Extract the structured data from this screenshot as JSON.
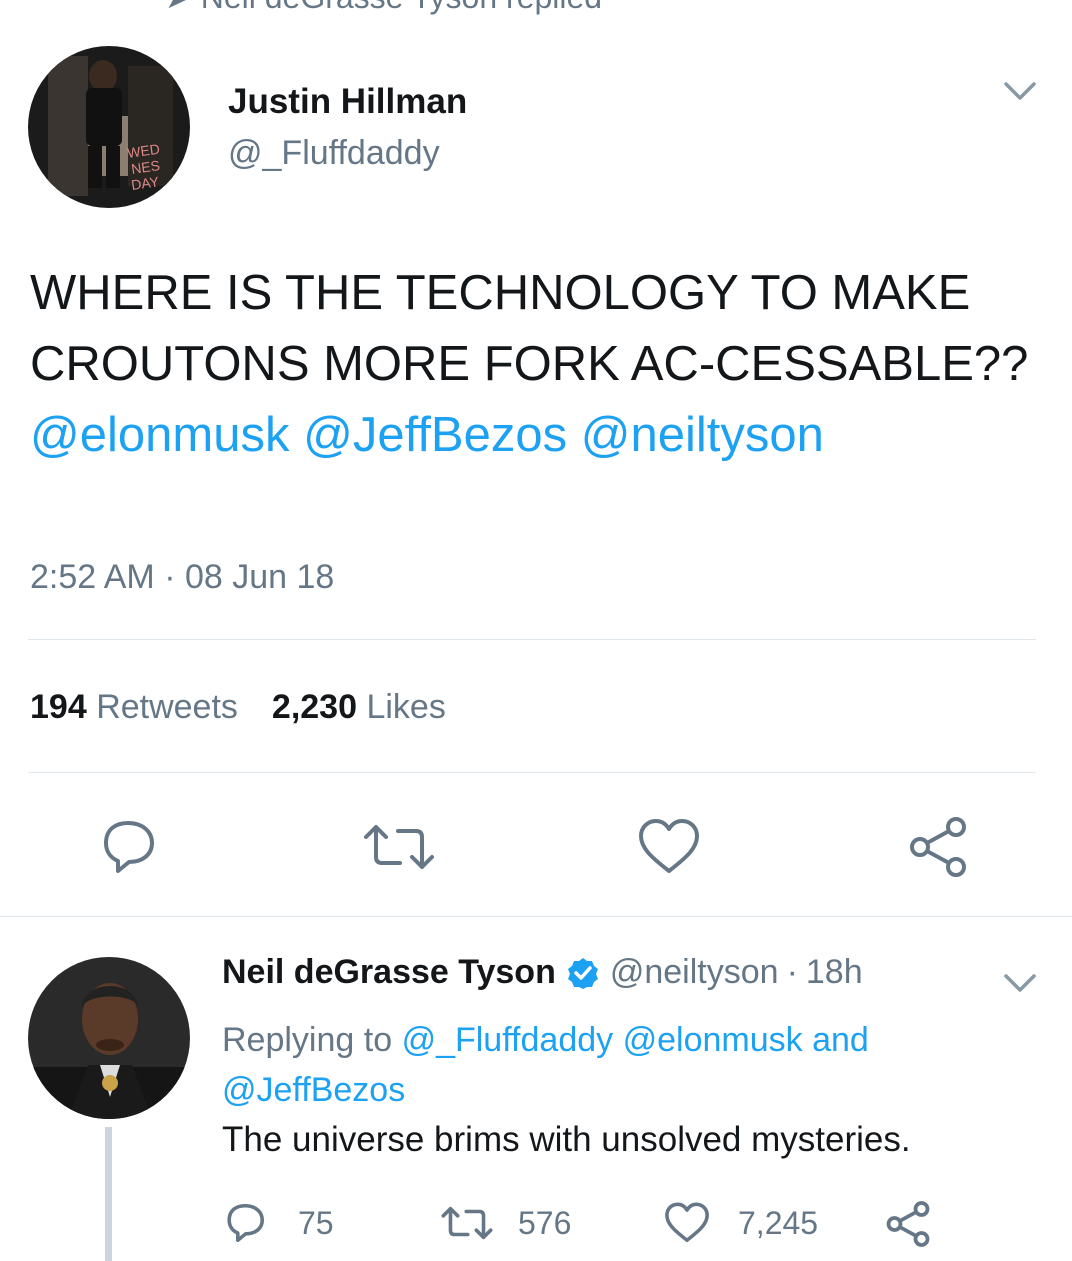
{
  "header": {
    "replied_banner": "Neil deGrasse Tyson replied"
  },
  "tweet": {
    "author_name": "Justin Hillman",
    "author_handle": "@_Fluffdaddy",
    "text_plain": "WHERE IS THE TECHNOLOGY TO MAKE CROUTONS MORE FORK AC-CESSABLE??",
    "mentions": [
      "@elonmusk",
      "@JeffBezos",
      "@neiltyson"
    ],
    "timestamp": "2:52 AM · 08 Jun 18",
    "retweets_count": "194",
    "retweets_label": "Retweets",
    "likes_count": "2,230",
    "likes_label": "Likes",
    "icons": [
      "reply-icon",
      "retweet-icon",
      "like-icon",
      "share-icon"
    ]
  },
  "reply": {
    "author_name": "Neil deGrasse Tyson",
    "verified": true,
    "author_handle": "@neiltyson",
    "age": "18h",
    "replying_prefix": "Replying to",
    "replying_to": [
      "@_Fluffdaddy",
      "@elonmusk"
    ],
    "replying_and": "and",
    "replying_last": "@JeffBezos",
    "text": "The universe brims with unsolved mysteries.",
    "reply_count": "75",
    "retweet_count": "576",
    "like_count": "7,245"
  },
  "colors": {
    "accent": "#1da1f2",
    "muted": "#657786",
    "text": "#14171a",
    "divider": "#e1e8ed"
  }
}
